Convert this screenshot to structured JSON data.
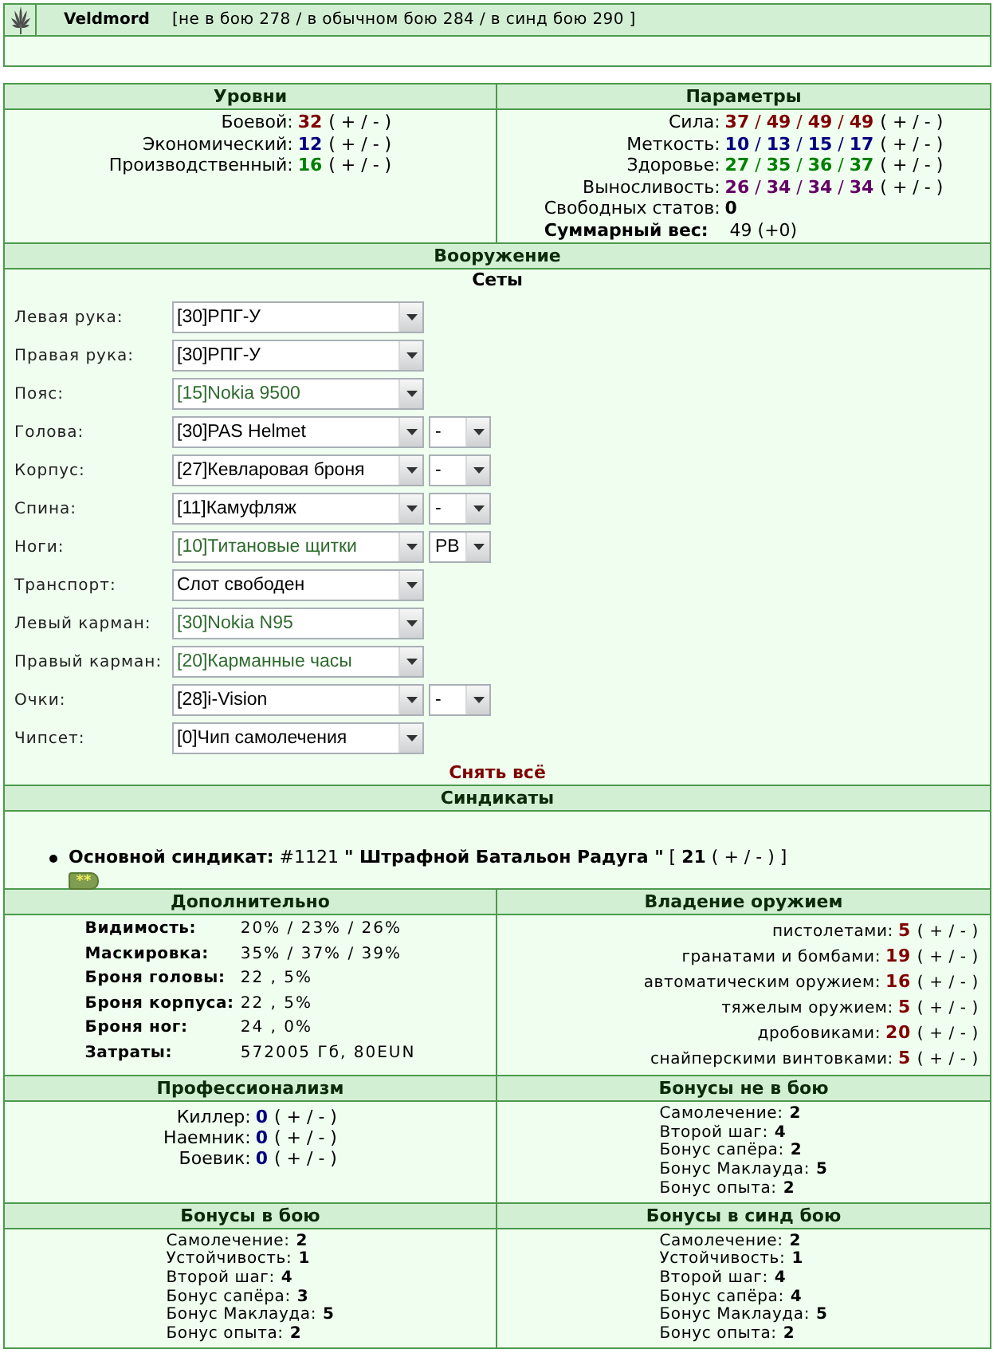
{
  "character": {
    "name": "Veldmord",
    "hp_summary": "[не в бою 278 / в обычном бою 284 / в синд бою 290 ]"
  },
  "levels": {
    "title": "Уровни",
    "items": [
      {
        "label": "Боевой:",
        "value": "32",
        "color": "#800000",
        "adjust": "( + / - )"
      },
      {
        "label": "Экономический:",
        "value": "12",
        "color": "#000080",
        "adjust": "( + / - )"
      },
      {
        "label": "Производственный:",
        "value": "16",
        "color": "#008000",
        "adjust": "( + / - )"
      }
    ]
  },
  "parameters": {
    "title": "Параметры",
    "stats": [
      {
        "label": "Сила:",
        "values": "**37** / **49** / **49** / **49**",
        "color": "#800000",
        "adjust": "( + / - )"
      },
      {
        "label": "Меткость:",
        "values": "**10** / **13** / **15** / **17**",
        "color": "#000080",
        "adjust": "( + / - )"
      },
      {
        "label": "Здоровье:",
        "values": "**27** / **35** / **36** / **37**",
        "color": "#008000",
        "adjust": "( + / - )"
      },
      {
        "label": "Выносливость:",
        "values": "**26** / **34** / **34** / **34**",
        "color": "#660066",
        "adjust": "( + / - )"
      }
    ],
    "free_stats": {
      "label": "Свободных статов:",
      "value": "0"
    },
    "total_weight": {
      "label": "Суммарный вес:",
      "value": "49 (+0)"
    }
  },
  "equipment": {
    "title": "Вооружение",
    "sets": "Сеты",
    "slots": [
      {
        "label": "Левая рука:",
        "item": "[30]РПГ-У",
        "color": "#000000"
      },
      {
        "label": "Правая рука:",
        "item": "[30]РПГ-У",
        "color": "#000000"
      },
      {
        "label": "Пояс:",
        "item": "[15]Nokia 9500",
        "color": "#2e6b2e"
      },
      {
        "label": "Голова:",
        "item": "[30]PAS Helmet",
        "color": "#000000",
        "modifier": "-"
      },
      {
        "label": "Корпус:",
        "item": "[27]Кевларовая броня",
        "color": "#000000",
        "modifier": "-"
      },
      {
        "label": "Спина:",
        "item": "[11]Камуфляж",
        "color": "#000000",
        "modifier": "-"
      },
      {
        "label": "Ноги:",
        "item": "[10]Титановые щитки",
        "color": "#2e6b2e",
        "modifier": "РВ"
      },
      {
        "label": "Транспорт:",
        "item": "Слот свободен",
        "color": "#000000"
      },
      {
        "label": "Левый карман:",
        "item": "[30]Nokia N95",
        "color": "#2e6b2e"
      },
      {
        "label": "Правый карман:",
        "item": "[20]Карманные часы",
        "color": "#2e6b2e"
      },
      {
        "label": "Очки:",
        "item": "[28]i-Vision",
        "color": "#000000",
        "modifier": "-"
      },
      {
        "label": "Чипсет:",
        "item": "[0]Чип самолечения",
        "color": "#000000"
      }
    ],
    "unequip_all": "Снять всё"
  },
  "syndicates": {
    "title": "Синдикаты",
    "items": [
      {
        "text": "**Основной синдикат:** #1121 **\" Штрафной Батальон Радуга \"** [ **21** ( + / - ) ]",
        "badge": "**"
      }
    ]
  },
  "additional": {
    "title": "Дополнительно",
    "rows": [
      {
        "label": "Видимость:",
        "value": "20% / 23% / 26%"
      },
      {
        "label": "Маскировка:",
        "value": "35% / 37% / 39%"
      },
      {
        "label": "Броня головы:",
        "value": "22 , 5%"
      },
      {
        "label": "Броня корпуса:",
        "value": "22 , 5%"
      },
      {
        "label": "Броня ног:",
        "value": "24 , 0%"
      },
      {
        "label": "Затраты:",
        "value": "572005 Гб, 80EUN"
      }
    ]
  },
  "weapon_skills": {
    "title": "Владение оружием",
    "rows": [
      {
        "label": "пистолетами:",
        "value": "5",
        "adjust": "( + / - )"
      },
      {
        "label": "гранатами и бомбами:",
        "value": "19",
        "adjust": "( + / - )"
      },
      {
        "label": "автоматическим оружием:",
        "value": "16",
        "adjust": "( + / - )"
      },
      {
        "label": "тяжелым оружием:",
        "value": "5",
        "adjust": "( + / - )"
      },
      {
        "label": "дробовиками:",
        "value": "20",
        "adjust": "( + / - )"
      },
      {
        "label": "снайперскими винтовками:",
        "value": "5",
        "adjust": "( + / - )"
      }
    ]
  },
  "professionalism": {
    "title": "Профессионализм",
    "rows": [
      {
        "label": "Киллер:",
        "value": "0",
        "adjust": "( + / - )"
      },
      {
        "label": "Наемник:",
        "value": "0",
        "adjust": "( + / - )"
      },
      {
        "label": "Боевик:",
        "value": "0",
        "adjust": "( + / - )"
      }
    ]
  },
  "bonuses_out_of_battle": {
    "title": "Бонусы не в бою",
    "rows": [
      {
        "label": "Самолечение:",
        "value": "2"
      },
      {
        "label": "Второй шаг:",
        "value": "4"
      },
      {
        "label": "Бонус сапёра:",
        "value": "2"
      },
      {
        "label": "Бонус Маклауда:",
        "value": "5"
      },
      {
        "label": "Бонус опыта:",
        "value": "2"
      }
    ]
  },
  "bonuses_in_battle": {
    "title": "Бонусы в бою",
    "rows": [
      {
        "label": "Самолечение:",
        "value": "2"
      },
      {
        "label": "Устойчивость:",
        "value": "1"
      },
      {
        "label": "Второй шаг:",
        "value": "4"
      },
      {
        "label": "Бонус сапёра:",
        "value": "3"
      },
      {
        "label": "Бонус Маклауда:",
        "value": "5"
      },
      {
        "label": "Бонус опыта:",
        "value": "2"
      }
    ]
  },
  "bonuses_in_synd_battle": {
    "title": "Бонусы в синд бою",
    "rows": [
      {
        "label": "Самолечение:",
        "value": "2"
      },
      {
        "label": "Устойчивость:",
        "value": "1"
      },
      {
        "label": "Второй шаг:",
        "value": "4"
      },
      {
        "label": "Бонус сапёра:",
        "value": "4"
      },
      {
        "label": "Бонус Маклауда:",
        "value": "5"
      },
      {
        "label": "Бонус опыта:",
        "value": "2"
      }
    ]
  }
}
